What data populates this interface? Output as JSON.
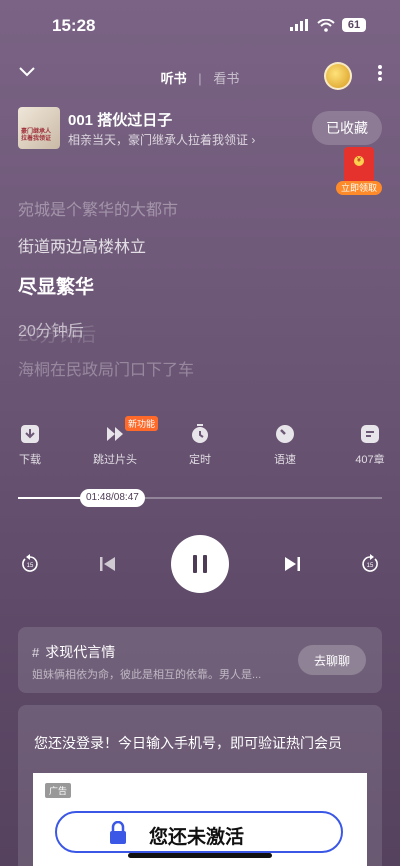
{
  "status": {
    "time": "15:28",
    "battery": "61"
  },
  "topbar": {
    "tab_listen": "听书",
    "tab_separator": "|",
    "tab_read": "看书"
  },
  "book": {
    "cover_text_line1": "豪门继承人",
    "cover_text_line2": "拉着我领证",
    "title": "001 搭伙过日子",
    "subtitle": "相亲当天，豪门继承人拉着我领证 ›",
    "favorite_label": "已收藏"
  },
  "redpack": {
    "label": "立即领取",
    "symbol": "¥"
  },
  "lyrics": [
    "宛城是个繁华的大都市",
    "街道两边高楼林立",
    "尽显繁华",
    "20分钟后",
    "海桐在民政局门口下了车"
  ],
  "controls": {
    "download": "下载",
    "skip_intro": "跳过片头",
    "new_badge": "新功能",
    "timer": "定时",
    "speed": "语速",
    "chapters": "407章"
  },
  "player": {
    "time_display": "01:48/08:47",
    "progress": 0.206,
    "skip_seconds": "15"
  },
  "recommend": {
    "hash": "#",
    "title": "求现代言情",
    "desc": "姐妹俩相依为命，彼此是相互的依靠。男人是...",
    "button": "去聊聊"
  },
  "promo": {
    "text": "您还没登录！今日输入手机号，即可验证热门会员",
    "ad_tag": "广告",
    "ad_button": "您还未激活"
  },
  "colors": {
    "background": "#6e5878",
    "accent_orange": "#ff8a2a",
    "ad_border": "#3b57e6"
  }
}
